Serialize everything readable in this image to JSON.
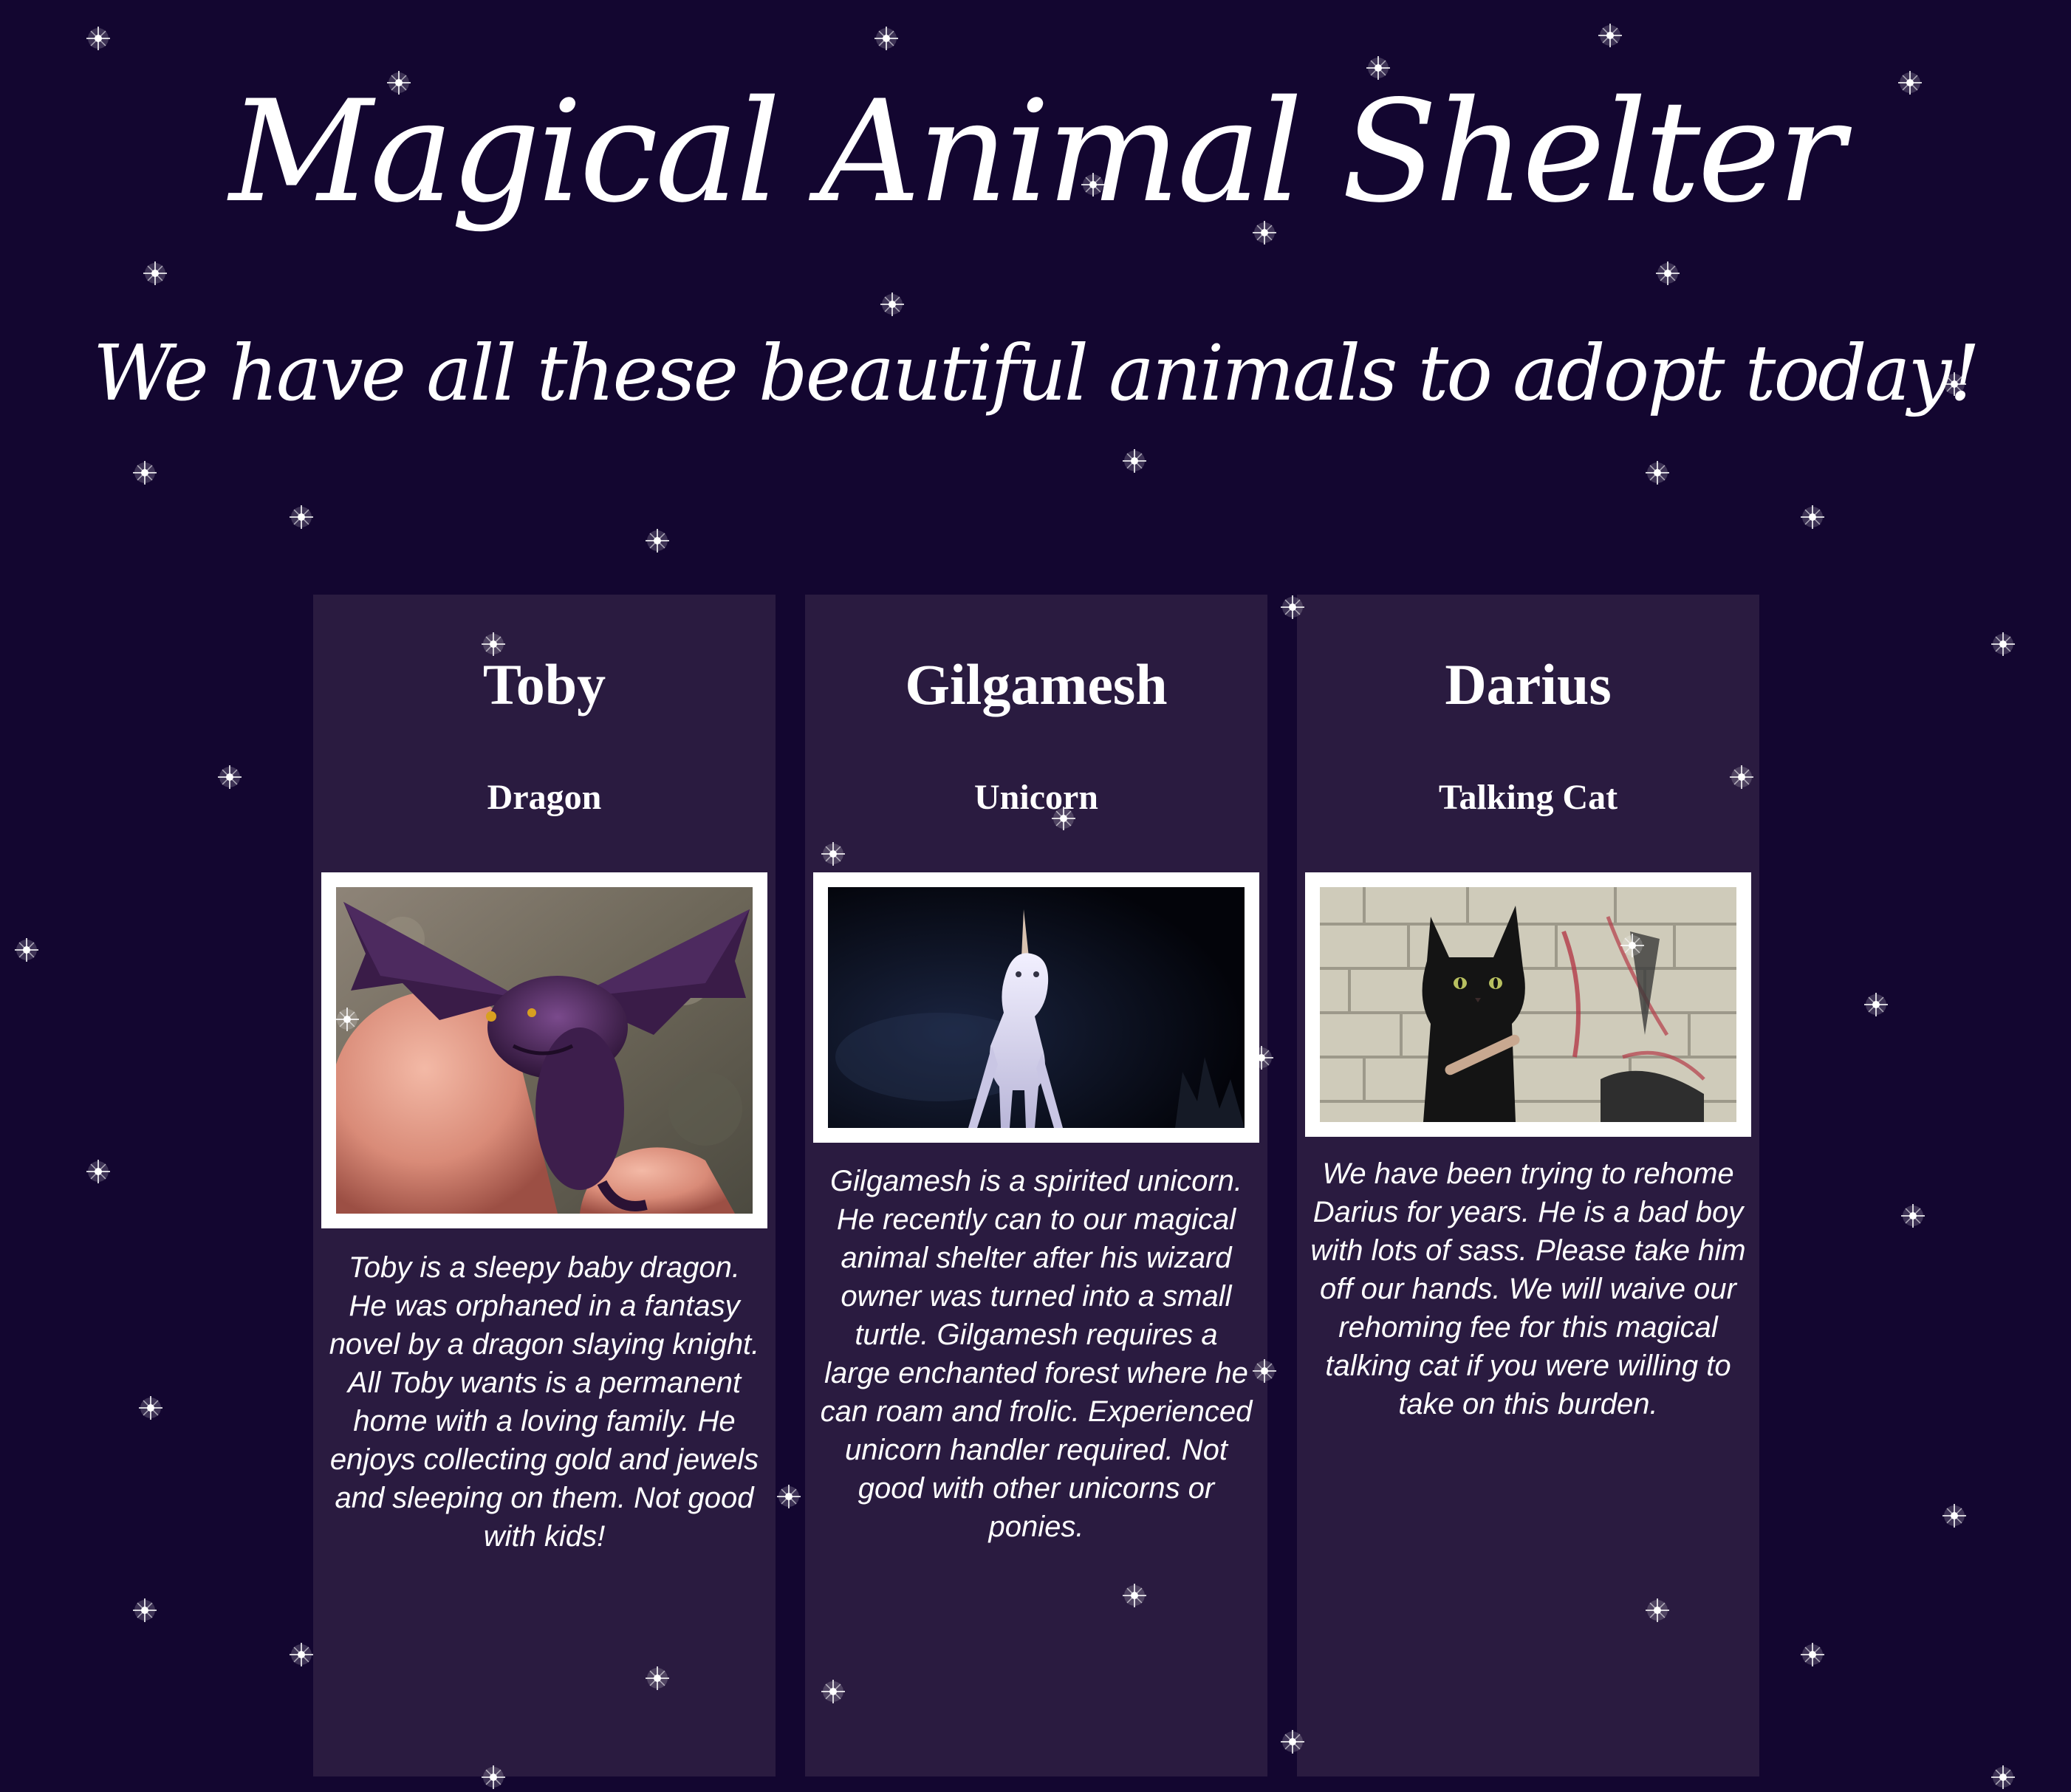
{
  "header": {
    "title": "Magical Animal Shelter",
    "subtitle": "We have all these beautiful animals to adopt today!"
  },
  "animals": [
    {
      "name": "Toby",
      "species": "Dragon",
      "description": "Toby is a sleepy baby dragon. He was orphaned in a fantasy novel by a dragon slaying knight. All Toby wants is a permanent home with a loving family. He enjoys collecting gold and jewels and sleeping on them. Not good with kids!"
    },
    {
      "name": "Gilgamesh",
      "species": "Unicorn",
      "description": "Gilgamesh is a spirited unicorn. He recently can to our magical animal shelter after his wizard owner was turned into a small turtle. Gilgamesh requires a large enchanted forest where he can roam and frolic. Experienced unicorn handler required. Not good with other unicorns or ponies."
    },
    {
      "name": "Darius",
      "species": "Talking Cat",
      "description": "We have been trying to rehome Darius for years. He is a bad boy with lots of sass. Please take him off our hands. We will waive our rehoming fee for this magical talking cat if you were willing to take on this burden."
    }
  ],
  "colors": {
    "background": "#130630",
    "card": "#2a1b40",
    "text": "#ffffff"
  }
}
